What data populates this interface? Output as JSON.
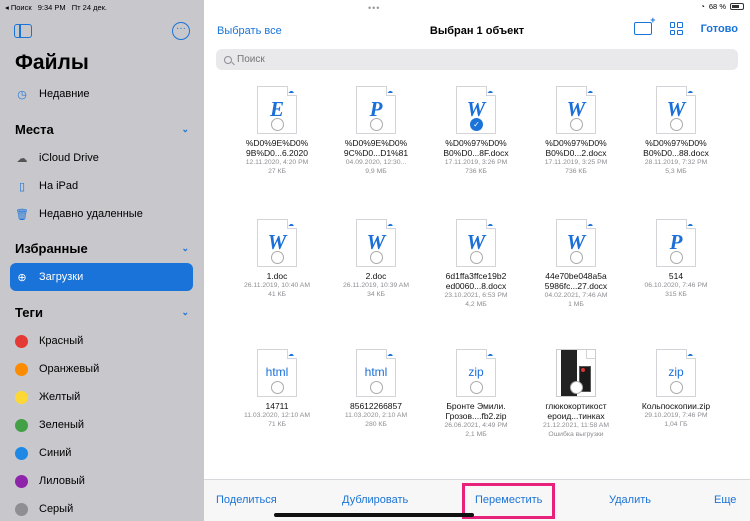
{
  "status_bar": {
    "left": [
      "◂ Поиск",
      "9:34 PM",
      "Пт 24 дек."
    ],
    "battery": "68 %"
  },
  "sidebar": {
    "title": "Файлы",
    "recent": "Недавние",
    "places_header": "Места",
    "places": [
      "iCloud Drive",
      "На iPad",
      "Недавно удаленные"
    ],
    "favorites_header": "Избранные",
    "favorites": [
      "Загрузки"
    ],
    "tags_header": "Теги",
    "tags": [
      {
        "label": "Красный",
        "color": "#e53935"
      },
      {
        "label": "Оранжевый",
        "color": "#fb8c00"
      },
      {
        "label": "Желтый",
        "color": "#fdd835"
      },
      {
        "label": "Зеленый",
        "color": "#43a047"
      },
      {
        "label": "Синий",
        "color": "#1e88e5"
      },
      {
        "label": "Лиловый",
        "color": "#8e24aa"
      },
      {
        "label": "Серый",
        "color": "#8e8e93"
      }
    ]
  },
  "nav": {
    "select_all": "Выбрать все",
    "title": "Выбран 1 объект",
    "done": "Готово"
  },
  "search": {
    "placeholder": "Поиск"
  },
  "files": [
    {
      "glyph": "E",
      "name1": "%D0%9E%D0%",
      "name2": "9B%D0...6.2020",
      "date": "12.11.2020, 4:20 PM",
      "size": "27 КБ"
    },
    {
      "glyph": "P",
      "name1": "%D0%9E%D0%",
      "name2": "9C%D0...D1%81",
      "date": "04.09.2020, 12:30...",
      "size": "9,9 МБ"
    },
    {
      "glyph": "W",
      "name1": "%D0%97%D0%",
      "name2": "B0%D0...8F.docx",
      "date": "17.11.2019, 3:26 PM",
      "size": "736 КБ"
    },
    {
      "glyph": "W",
      "name1": "%D0%97%D0%",
      "name2": "B0%D0...2.docx",
      "date": "17.11.2019, 3:25 PM",
      "size": "736 КБ"
    },
    {
      "glyph": "W",
      "name1": "%D0%97%D0%",
      "name2": "B0%D0...88.docx",
      "date": "28.11.2019, 7:32 PM",
      "size": "5,3 МБ"
    },
    {
      "glyph": "W",
      "name1": "1.doc",
      "name2": "",
      "date": "26.11.2019, 10:40 AM",
      "size": "41 КБ"
    },
    {
      "glyph": "W",
      "name1": "2.doc",
      "name2": "",
      "date": "26.11.2019, 10:39 AM",
      "size": "34 КБ"
    },
    {
      "glyph": "W",
      "name1": "6d1ffa3ffce19b2",
      "name2": "ed0060...8.docx",
      "date": "23.10.2021, 6:53 PM",
      "size": "4,2 МБ"
    },
    {
      "glyph": "W",
      "name1": "44e70be048a5a",
      "name2": "5986fc...27.docx",
      "date": "04.02.2021, 7:46 AM",
      "size": "1 МБ"
    },
    {
      "glyph": "P",
      "name1": "514",
      "name2": "",
      "date": "06.10.2020, 7:46 PM",
      "size": "315 КБ"
    },
    {
      "ext": "html",
      "name1": "14711",
      "name2": "",
      "date": "11.03.2020, 12:10 AM",
      "size": "71 КБ"
    },
    {
      "ext": "html",
      "name1": "85612266857",
      "name2": "",
      "date": "11.03.2020, 2:10 AM",
      "size": "280 КБ"
    },
    {
      "ext": "zip",
      "name1": "Бронте Эмили.",
      "name2": "Грозов....fb2.zip",
      "date": "26.06.2021, 4:49 PM",
      "size": "2,1 МБ"
    },
    {
      "photo": true,
      "name1": "глюкокортикост",
      "name2": "ероид...тинках",
      "date": "21.12.2021, 11:58 AM",
      "size": "Ошибка выгрузки"
    },
    {
      "ext": "zip",
      "name1": "Кольпоскопии.zip",
      "name2": "",
      "date": "29.10.2019, 7:46 PM",
      "size": "1,04 ГБ"
    }
  ],
  "toolbar": {
    "share": "Поделиться",
    "duplicate": "Дублировать",
    "move": "Переместить",
    "delete": "Удалить",
    "more": "Еще"
  },
  "colors": {
    "accent": "#1a73d8",
    "highlight": "#e8217a",
    "sidebar_bg": "#c7c7cc"
  }
}
